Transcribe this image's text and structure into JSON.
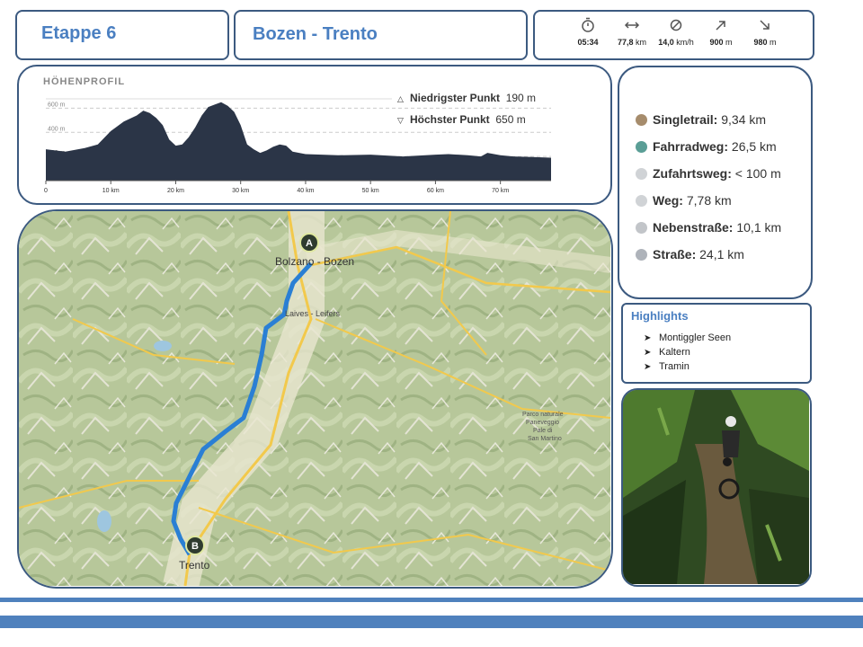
{
  "header": {
    "stage": "Etappe 6",
    "route": "Bozen - Trento"
  },
  "stats": [
    {
      "icon": "stopwatch-icon",
      "value": "05:34",
      "unit": ""
    },
    {
      "icon": "distance-icon",
      "value": "77,8",
      "unit": " km"
    },
    {
      "icon": "speed-icon",
      "value": "14,0",
      "unit": " km/h"
    },
    {
      "icon": "ascent-icon",
      "value": "900",
      "unit": " m"
    },
    {
      "icon": "descent-icon",
      "value": "980",
      "unit": " m"
    }
  ],
  "profile": {
    "title": "HÖHENPROFIL",
    "lowest_label": "Niedrigster Punkt",
    "lowest_value": "190 m",
    "highest_label": "Höchster Punkt",
    "highest_value": "650 m"
  },
  "chart_data": {
    "type": "area",
    "title": "HÖHENPROFIL",
    "xlabel": "",
    "ylabel": "",
    "x_unit": "km",
    "y_unit": "m",
    "xlim": [
      0,
      77.8
    ],
    "ylim": [
      0,
      700
    ],
    "x_ticks": [
      "0",
      "10 km",
      "20 km",
      "30 km",
      "40 km",
      "50 km",
      "60 km",
      "70 km"
    ],
    "x_tick_values": [
      0,
      10,
      20,
      30,
      40,
      50,
      60,
      70
    ],
    "y_ticks": [
      "200 m",
      "400 m",
      "600 m"
    ],
    "y_tick_values": [
      200,
      400,
      600
    ],
    "grid": true,
    "x": [
      0,
      3,
      6,
      8,
      10,
      12,
      14,
      15,
      16,
      17,
      18,
      19,
      20,
      21,
      22,
      23,
      24,
      25,
      26,
      27,
      28,
      29,
      30,
      31,
      32,
      33,
      34,
      35,
      36,
      37,
      38,
      40,
      45,
      50,
      55,
      60,
      62,
      65,
      67,
      68,
      70,
      72,
      75,
      77.8
    ],
    "values": [
      260,
      240,
      270,
      300,
      410,
      490,
      540,
      580,
      560,
      520,
      460,
      340,
      290,
      300,
      360,
      440,
      540,
      610,
      630,
      650,
      620,
      570,
      460,
      300,
      260,
      230,
      250,
      280,
      300,
      290,
      240,
      220,
      210,
      215,
      200,
      215,
      220,
      210,
      200,
      230,
      210,
      200,
      195,
      190
    ]
  },
  "surfaces": [
    {
      "label": "Singletrail:",
      "value": "9,34 km",
      "color": "#a68c6c"
    },
    {
      "label": "Fahrradweg:",
      "value": "26,5 km",
      "color": "#5a9e96"
    },
    {
      "label": "Zufahrtsweg:",
      "value": "< 100 m",
      "color": "#d0d3d6"
    },
    {
      "label": "Weg:",
      "value": "7,78 km",
      "color": "#d0d3d6"
    },
    {
      "label": "Nebenstraße:",
      "value": "10,1 km",
      "color": "#c2c5c9"
    },
    {
      "label": "Straße:",
      "value": "24,1 km",
      "color": "#aeb3ba"
    }
  ],
  "highlights": {
    "title": "Highlights",
    "items": [
      "Montiggler Seen",
      "Kaltern",
      "Tramin"
    ]
  },
  "map": {
    "start_marker": "A",
    "end_marker": "B",
    "labels": {
      "bozen": "Bolzano - Bozen",
      "leifers": "Laives - Leifers",
      "trento": "Trento",
      "park_1": "Parco naturale",
      "park_2": "Paneveggio",
      "park_3": "Pale di",
      "park_4": "San Martino"
    }
  },
  "colors": {
    "accent": "#4a7fc1",
    "border": "#3c5a80",
    "route": "#2a7fd4",
    "profile_fill": "#2b3547"
  }
}
